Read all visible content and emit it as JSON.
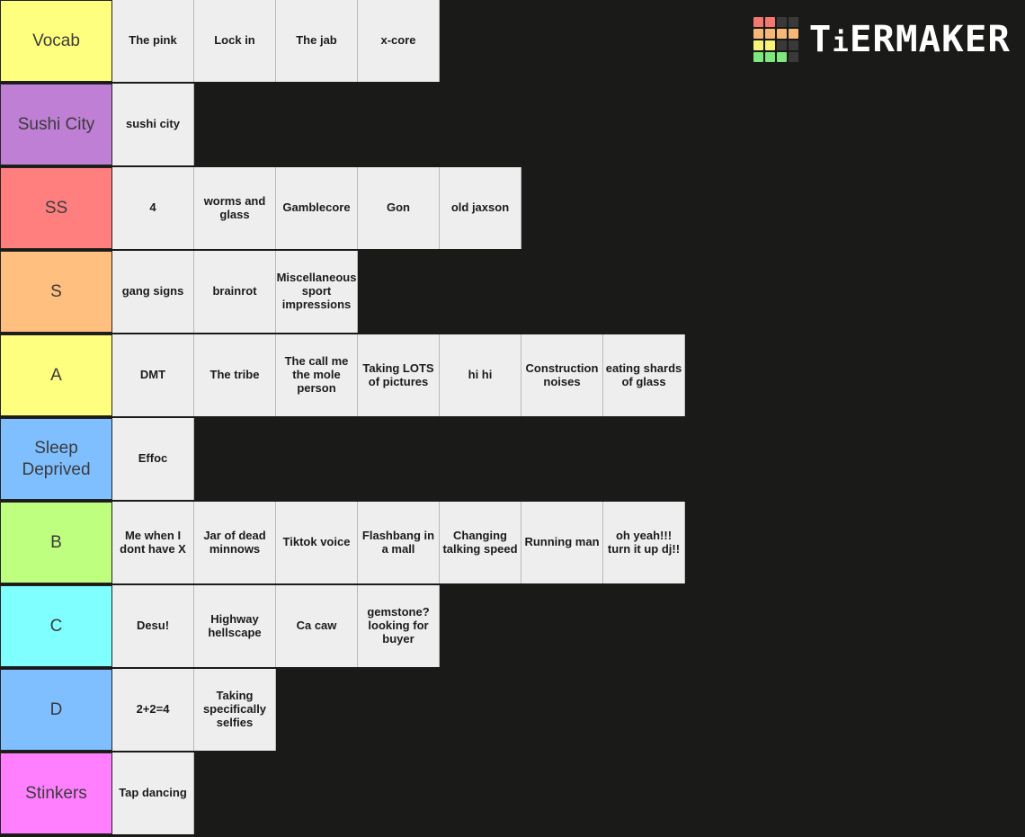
{
  "watermark": {
    "brand": "TiERMAKER",
    "brand_prefix": "T",
    "brand_i": "i",
    "brand_rest": "ERMAKER",
    "logo_name": "tiermaker-logo",
    "logo_colors": [
      "#f4786f",
      "#f4786f",
      "#39393a",
      "#39393a",
      "#f5b877",
      "#f5b877",
      "#f5b877",
      "#f5b877",
      "#f7f477",
      "#f7f477",
      "#39393a",
      "#39393a",
      "#7ee87e",
      "#7ee87e",
      "#7ee87e",
      "#39393a"
    ]
  },
  "background_color": "#1a1a18",
  "item_color": "#eeeeee",
  "rows": [
    {
      "label": "Vocab",
      "color": "#ffff7f",
      "items": [
        "The pink",
        "Lock in",
        "The jab",
        "x-core"
      ]
    },
    {
      "label": "Sushi City",
      "color": "#bf7fd4",
      "items": [
        "sushi city"
      ]
    },
    {
      "label": "SS",
      "color": "#ff7f7f",
      "items": [
        "4",
        "worms and glass",
        "Gamblecore",
        "Gon",
        "old jaxson"
      ]
    },
    {
      "label": "S",
      "color": "#ffbf7f",
      "items": [
        "gang signs",
        "brainrot",
        "Miscellaneous sport impressions"
      ]
    },
    {
      "label": "A",
      "color": "#ffff7f",
      "items": [
        "DMT",
        "The tribe",
        "The call me the mole person",
        "Taking LOTS of pictures",
        "hi hi",
        "Construction noises",
        "eating shards of glass"
      ]
    },
    {
      "label": "Sleep Deprived",
      "color": "#7fbfff",
      "items": [
        "Effoc"
      ]
    },
    {
      "label": "B",
      "color": "#bfff7f",
      "items": [
        "Me when I dont have X",
        "Jar of dead minnows",
        "Tiktok voice",
        "Flashbang in a mall",
        "Changing talking speed",
        "Running man",
        "oh yeah!!! turn it up dj!!"
      ]
    },
    {
      "label": "C",
      "color": "#7fffff",
      "items": [
        "Desu!",
        "Highway hellscape",
        "Ca caw",
        "gemstone? looking for buyer"
      ]
    },
    {
      "label": "D",
      "color": "#7fbfff",
      "items": [
        "2+2=4",
        "Taking specifically selfies"
      ]
    },
    {
      "label": "Stinkers",
      "color": "#ff7fff",
      "items": [
        "Tap dancing"
      ]
    }
  ]
}
